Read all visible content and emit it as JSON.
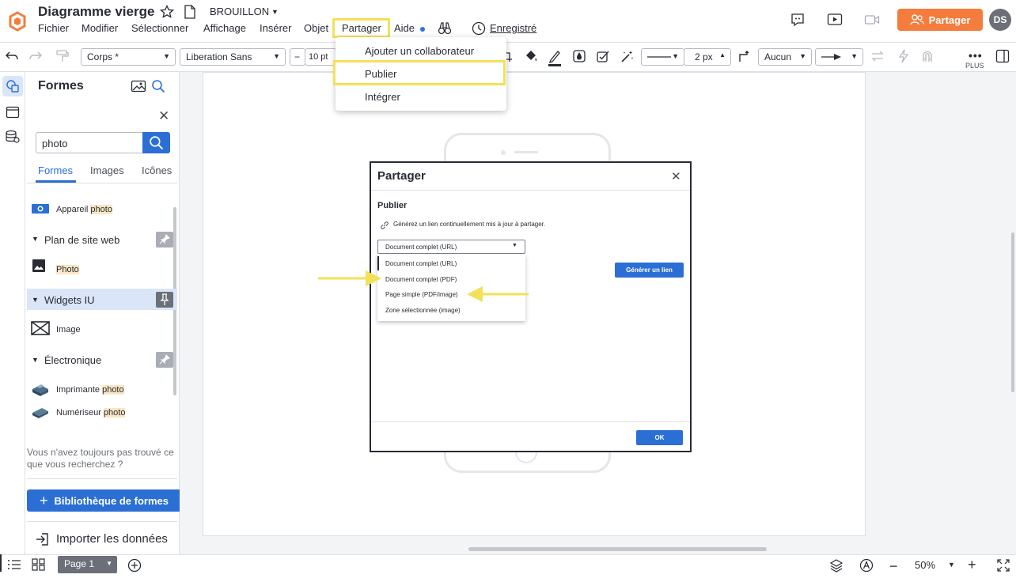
{
  "header": {
    "doc_title": "Diagramme vierge",
    "draft_label": "BROUILLON",
    "menus": [
      "Fichier",
      "Modifier",
      "Sélectionner",
      "Affichage",
      "Insérer",
      "Objet",
      "Partager",
      "Aide"
    ],
    "saved_label": "Enregistré",
    "share_button": "Partager",
    "avatar_initials": "DS"
  },
  "toolbar": {
    "text_style": "Corps *",
    "font": "Liberation Sans",
    "font_size": "10 pt",
    "line_width": "2 px",
    "arrow_start": "Aucun",
    "more_label": "PLUS"
  },
  "share_menu": {
    "items": [
      "Ajouter un collaborateur",
      "Publier",
      "Intégrer"
    ]
  },
  "shapes_panel": {
    "title": "Formes",
    "search_value": "photo",
    "tabs": [
      "Formes",
      "Images",
      "Icônes"
    ],
    "item_camera_prefix": "Appareil ",
    "item_highlight": "photo",
    "section_sitemap": "Plan de site web",
    "item_photo": "Photo",
    "section_widgets": "Widgets IU",
    "item_image": "Image",
    "section_electronics": "Électronique",
    "item_printer_prefix": "Imprimante ",
    "item_scanner_prefix": "Numériseur ",
    "not_found_text": "Vous n'avez toujours pas trouvé ce que vous recherchez ?",
    "library_button": "Bibliothèque de formes",
    "import_label": "Importer les données"
  },
  "dialog": {
    "title": "Partager",
    "subtitle": "Publier",
    "description": "Générez un lien continuellement mis à jour à partager.",
    "selected": "Document complet (URL)",
    "options": [
      "Document complet (URL)",
      "Document complet (PDF)",
      "Page simple (PDF/image)",
      "Zone sélectionnée (image)"
    ],
    "generate_button": "Générer un lien",
    "ok_button": "OK"
  },
  "bottom": {
    "page_label": "Page 1",
    "zoom": "50%"
  },
  "colors": {
    "accent": "#2b6fd5",
    "share_orange": "#f47c3c",
    "highlight_yellow": "#f2e15a"
  }
}
